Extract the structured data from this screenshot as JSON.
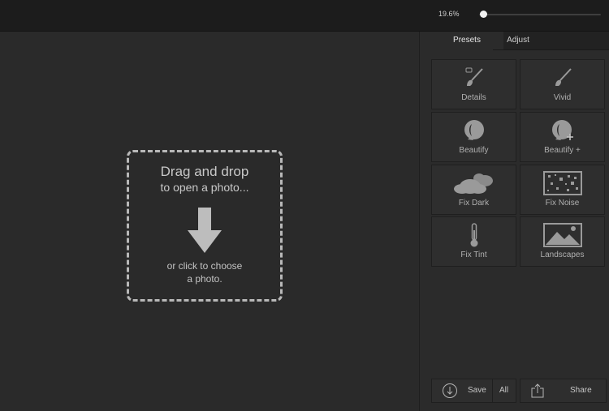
{
  "topbar": {
    "zoom_text": "19.6%",
    "zoom_value": 0.196
  },
  "dropzone": {
    "title": "Drag and drop",
    "subtitle": "to open a photo...",
    "hint_line1": "or click to choose",
    "hint_line2": "a photo."
  },
  "sidebar": {
    "tabs": [
      {
        "label": "Presets",
        "active": true
      },
      {
        "label": "Adjust",
        "active": false
      }
    ],
    "presets": [
      {
        "label": "Details",
        "icon": "brush-icon"
      },
      {
        "label": "Vivid",
        "icon": "brush-icon"
      },
      {
        "label": "Beautify",
        "icon": "face-icon"
      },
      {
        "label": "Beautify +",
        "icon": "face-plus-icon"
      },
      {
        "label": "Fix Dark",
        "icon": "cloud-icon"
      },
      {
        "label": "Fix Noise",
        "icon": "noise-icon"
      },
      {
        "label": "Fix Tint",
        "icon": "thermometer-icon"
      },
      {
        "label": "Landscapes",
        "icon": "landscape-icon"
      }
    ],
    "bottom": {
      "save_label": "Save",
      "all_label": "All",
      "share_label": "Share"
    }
  },
  "colors": {
    "background": "#2a2a2a",
    "topbar": "#1c1c1c",
    "tile": "#2e2e2e",
    "text": "#b0b0b0",
    "accent": "#f2f2f2"
  }
}
